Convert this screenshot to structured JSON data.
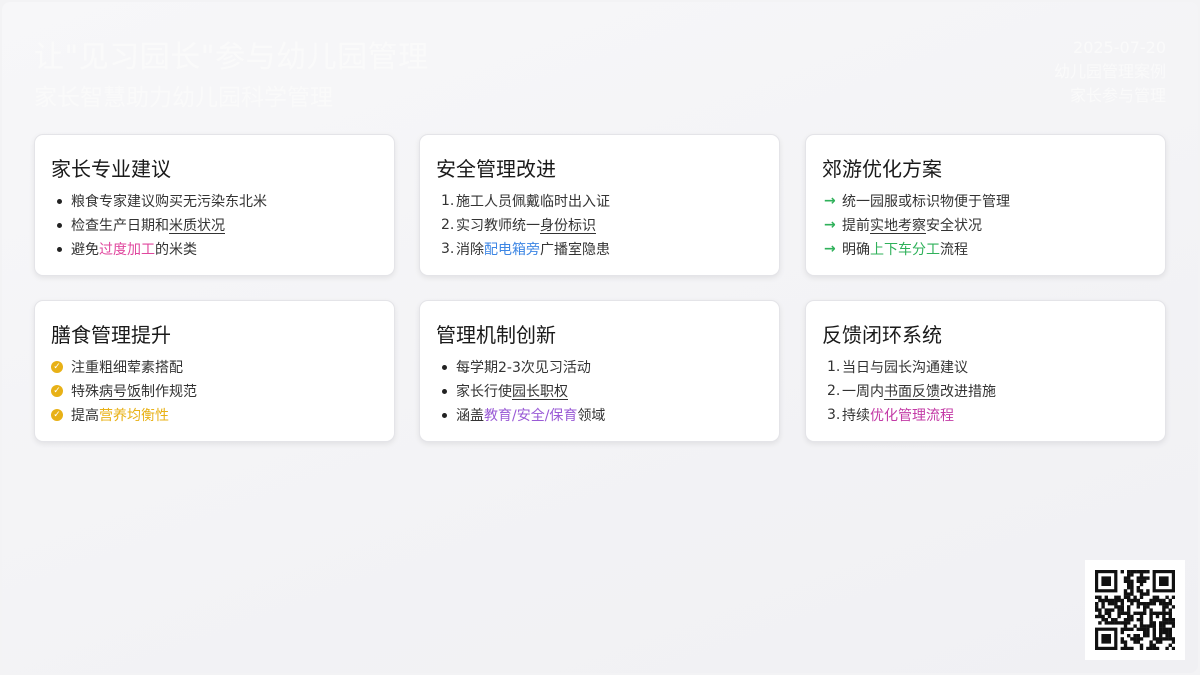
{
  "header": {
    "title": "让\"见习园长\"参与幼儿园管理",
    "subtitle": "家长智慧助力幼儿园科学管理",
    "date": "2025-07-20",
    "tag1": "幼儿园管理案例",
    "tag2": "家长参与管理"
  },
  "cards": [
    {
      "title": "家长专业建议",
      "items": [
        {
          "parts": [
            {
              "t": "粮食专家建议购买无污染东北米"
            }
          ]
        },
        {
          "parts": [
            {
              "t": "检查生产日期和"
            },
            {
              "t": "米质状况",
              "cls": "u"
            }
          ]
        },
        {
          "parts": [
            {
              "t": "避免"
            },
            {
              "t": "过度加工",
              "cls": "pink"
            },
            {
              "t": "的米类"
            }
          ]
        }
      ]
    },
    {
      "title": "安全管理改进",
      "items": [
        {
          "parts": [
            {
              "t": "施工人员佩戴临时出入证"
            }
          ]
        },
        {
          "parts": [
            {
              "t": "实习教师统一"
            },
            {
              "t": "身份标识",
              "cls": "u"
            }
          ]
        },
        {
          "parts": [
            {
              "t": "消除"
            },
            {
              "t": "配电箱旁",
              "cls": "blue"
            },
            {
              "t": "广播室隐患"
            }
          ]
        }
      ]
    },
    {
      "title": "郊游优化方案",
      "items": [
        {
          "parts": [
            {
              "t": "统一园服或标识物便于管理"
            }
          ]
        },
        {
          "parts": [
            {
              "t": "提前"
            },
            {
              "t": "实地考察",
              "cls": "u"
            },
            {
              "t": "安全状况"
            }
          ]
        },
        {
          "parts": [
            {
              "t": "明确"
            },
            {
              "t": "上下车分工",
              "cls": "green"
            },
            {
              "t": "流程"
            }
          ]
        }
      ]
    },
    {
      "title": "膳食管理提升",
      "items": [
        {
          "parts": [
            {
              "t": "注重粗细荤素搭配"
            }
          ]
        },
        {
          "parts": [
            {
              "t": "特殊"
            },
            {
              "t": "病号饭",
              "cls": "u"
            },
            {
              "t": "制作规范"
            }
          ]
        },
        {
          "parts": [
            {
              "t": "提高"
            },
            {
              "t": "营养均衡性",
              "cls": "gold"
            }
          ]
        }
      ]
    },
    {
      "title": "管理机制创新",
      "items": [
        {
          "parts": [
            {
              "t": "每学期"
            },
            {
              "t": "2-3"
            },
            {
              "t": "次见习活动"
            }
          ]
        },
        {
          "parts": [
            {
              "t": "家长行使"
            },
            {
              "t": "园长职权",
              "cls": "u"
            }
          ]
        },
        {
          "parts": [
            {
              "t": "涵盖"
            },
            {
              "t": "教育/安全/保育",
              "cls": "purple"
            },
            {
              "t": "领域"
            }
          ]
        }
      ]
    },
    {
      "title": "反馈闭环系统",
      "items": [
        {
          "parts": [
            {
              "t": "当日与园长沟通建议"
            }
          ]
        },
        {
          "parts": [
            {
              "t": "一周内"
            },
            {
              "t": "书面反馈",
              "cls": "u"
            },
            {
              "t": "改进措施"
            }
          ]
        },
        {
          "parts": [
            {
              "t": "持续"
            },
            {
              "t": "优化管理流程",
              "cls": "magenta"
            }
          ]
        }
      ]
    }
  ],
  "markers": [
    "dot",
    "num",
    "arrow",
    "check",
    "dot",
    "num"
  ],
  "qr_icon": "qr-code-icon"
}
